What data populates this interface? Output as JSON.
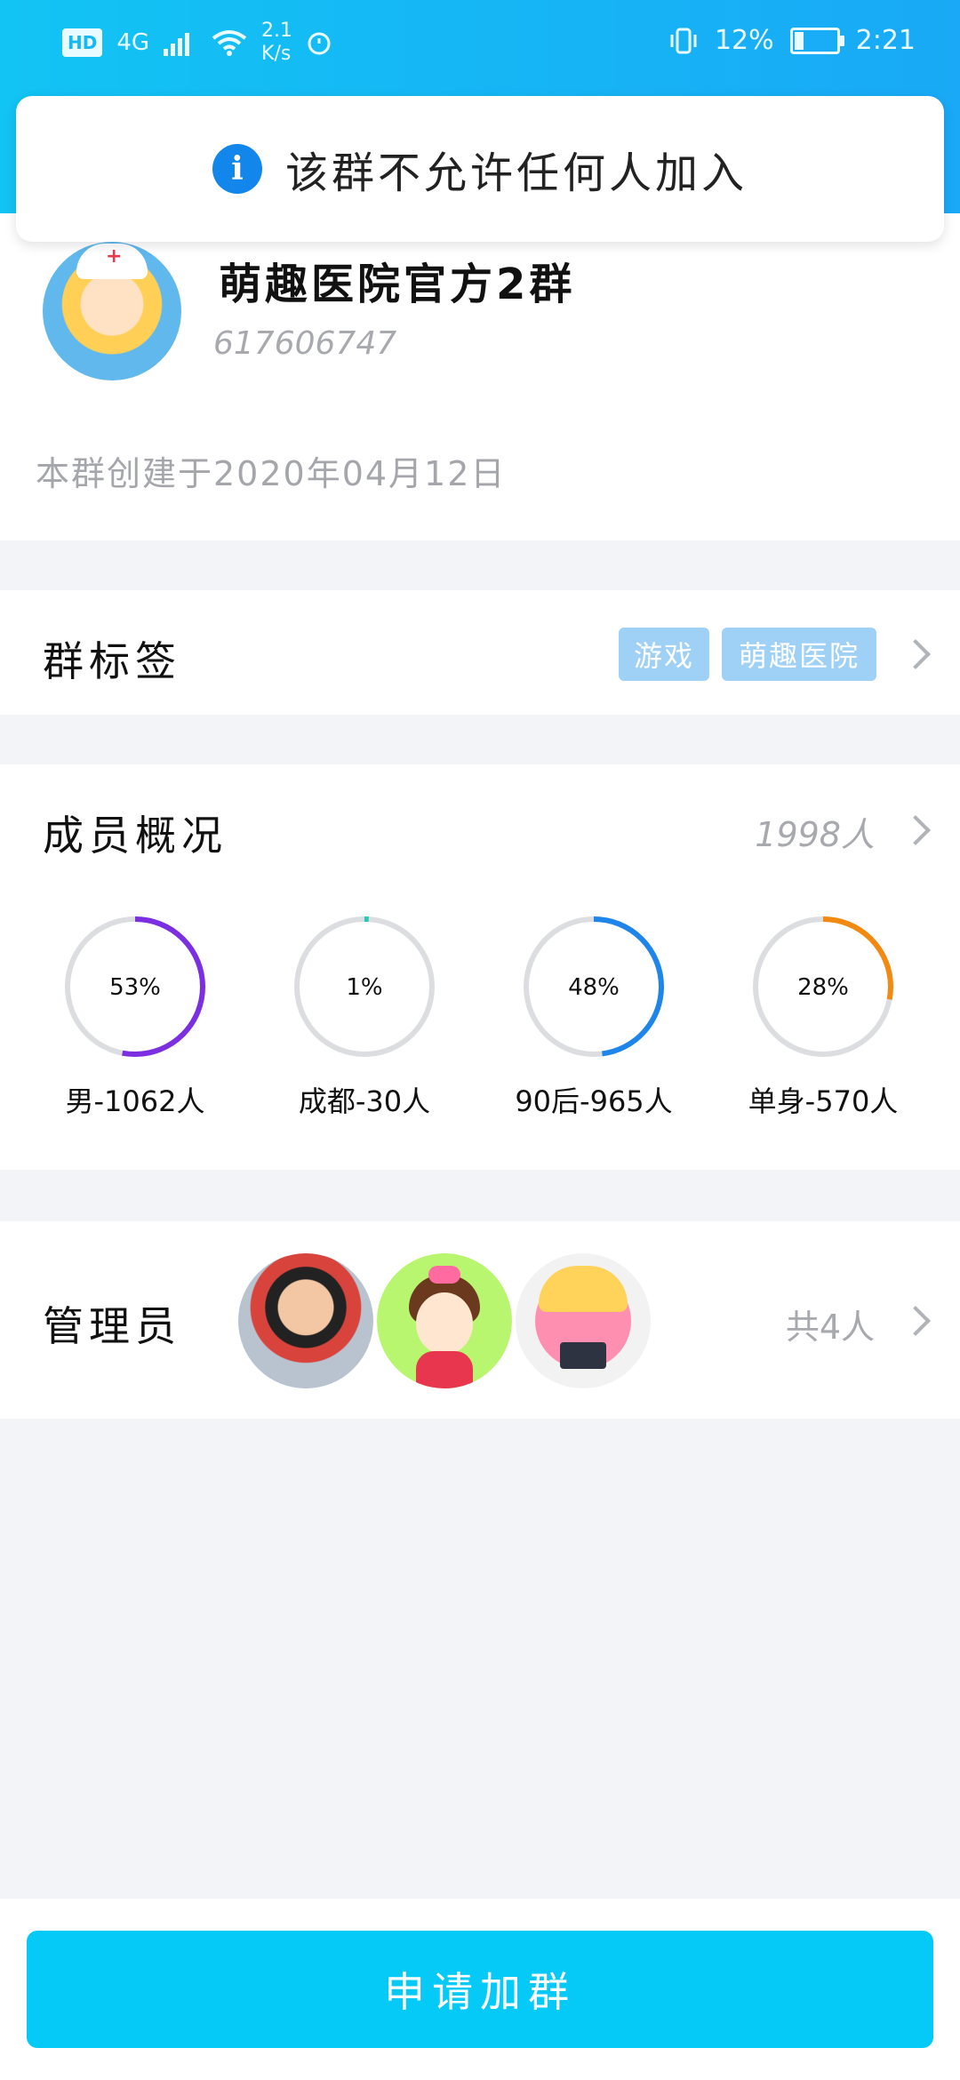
{
  "status_bar": {
    "hd": "HD",
    "network": "4G",
    "speed_value": "2.1",
    "speed_unit": "K/s",
    "battery": "12%",
    "time": "2:21"
  },
  "toast": {
    "text": "该群不允许任何人加入"
  },
  "group": {
    "name": "萌趣医院官方2群",
    "id": "617606747",
    "created": "本群创建于2020年04月12日"
  },
  "tags_row": {
    "title": "群标签",
    "tags": [
      "游戏",
      "萌趣医院"
    ]
  },
  "members": {
    "title": "成员概况",
    "count": "1998人",
    "stats": [
      {
        "percent_label": "53%",
        "label": "男-1062人",
        "value": 53,
        "color": "#7b2fe0"
      },
      {
        "percent_label": "1%",
        "label": "成都-30人",
        "value": 1,
        "color": "#26c8b6"
      },
      {
        "percent_label": "48%",
        "label": "90后-965人",
        "value": 48,
        "color": "#1e86ea"
      },
      {
        "percent_label": "28%",
        "label": "单身-570人",
        "value": 28,
        "color": "#f28a12"
      }
    ]
  },
  "admins": {
    "title": "管理员",
    "count": "共4人"
  },
  "bottom": {
    "join_label": "申请加群"
  },
  "colors": {
    "header": "#12c4f4",
    "button": "#05c9f7",
    "tag": "#9fd1f7",
    "info": "#1386ec"
  }
}
